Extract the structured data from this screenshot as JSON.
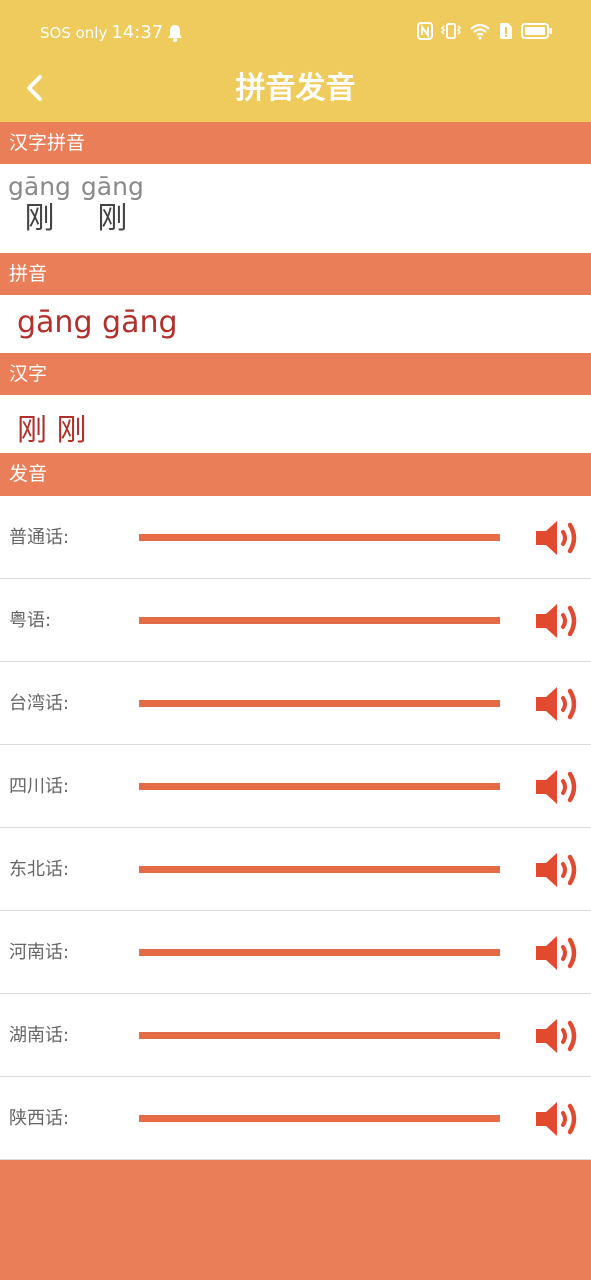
{
  "status_bar": {
    "carrier": "SOS only",
    "time": "14:37",
    "icons": [
      "bell-icon",
      "nfc-icon",
      "vibrate-icon",
      "wifi-icon",
      "sim-alert-icon",
      "battery-icon"
    ]
  },
  "header": {
    "title": "拼音发音",
    "back_icon": "chevron-left-icon"
  },
  "sections": {
    "hanzi_pinyin": {
      "title": "汉字拼音",
      "pairs": [
        {
          "pinyin": "gāng",
          "hanzi": "刚"
        },
        {
          "pinyin": "gāng",
          "hanzi": "刚"
        }
      ]
    },
    "pinyin": {
      "title": "拼音",
      "value": "gāng gāng"
    },
    "hanzi": {
      "title": "汉字",
      "value": "刚 刚"
    },
    "pronunciation": {
      "title": "发音",
      "dialects": [
        {
          "label": "普通话:",
          "icon": "speaker-icon"
        },
        {
          "label": "粤语:",
          "icon": "speaker-icon"
        },
        {
          "label": "台湾话:",
          "icon": "speaker-icon"
        },
        {
          "label": "四川话:",
          "icon": "speaker-icon"
        },
        {
          "label": "东北话:",
          "icon": "speaker-icon"
        },
        {
          "label": "河南话:",
          "icon": "speaker-icon"
        },
        {
          "label": "湖南话:",
          "icon": "speaker-icon"
        },
        {
          "label": "陕西话:",
          "icon": "speaker-icon"
        }
      ]
    }
  },
  "colors": {
    "header_bg": "#eecb5c",
    "section_bg": "#e97e58",
    "accent_red": "#b2302b",
    "bar_color": "#e56a46",
    "speaker_color": "#e24a2f"
  }
}
